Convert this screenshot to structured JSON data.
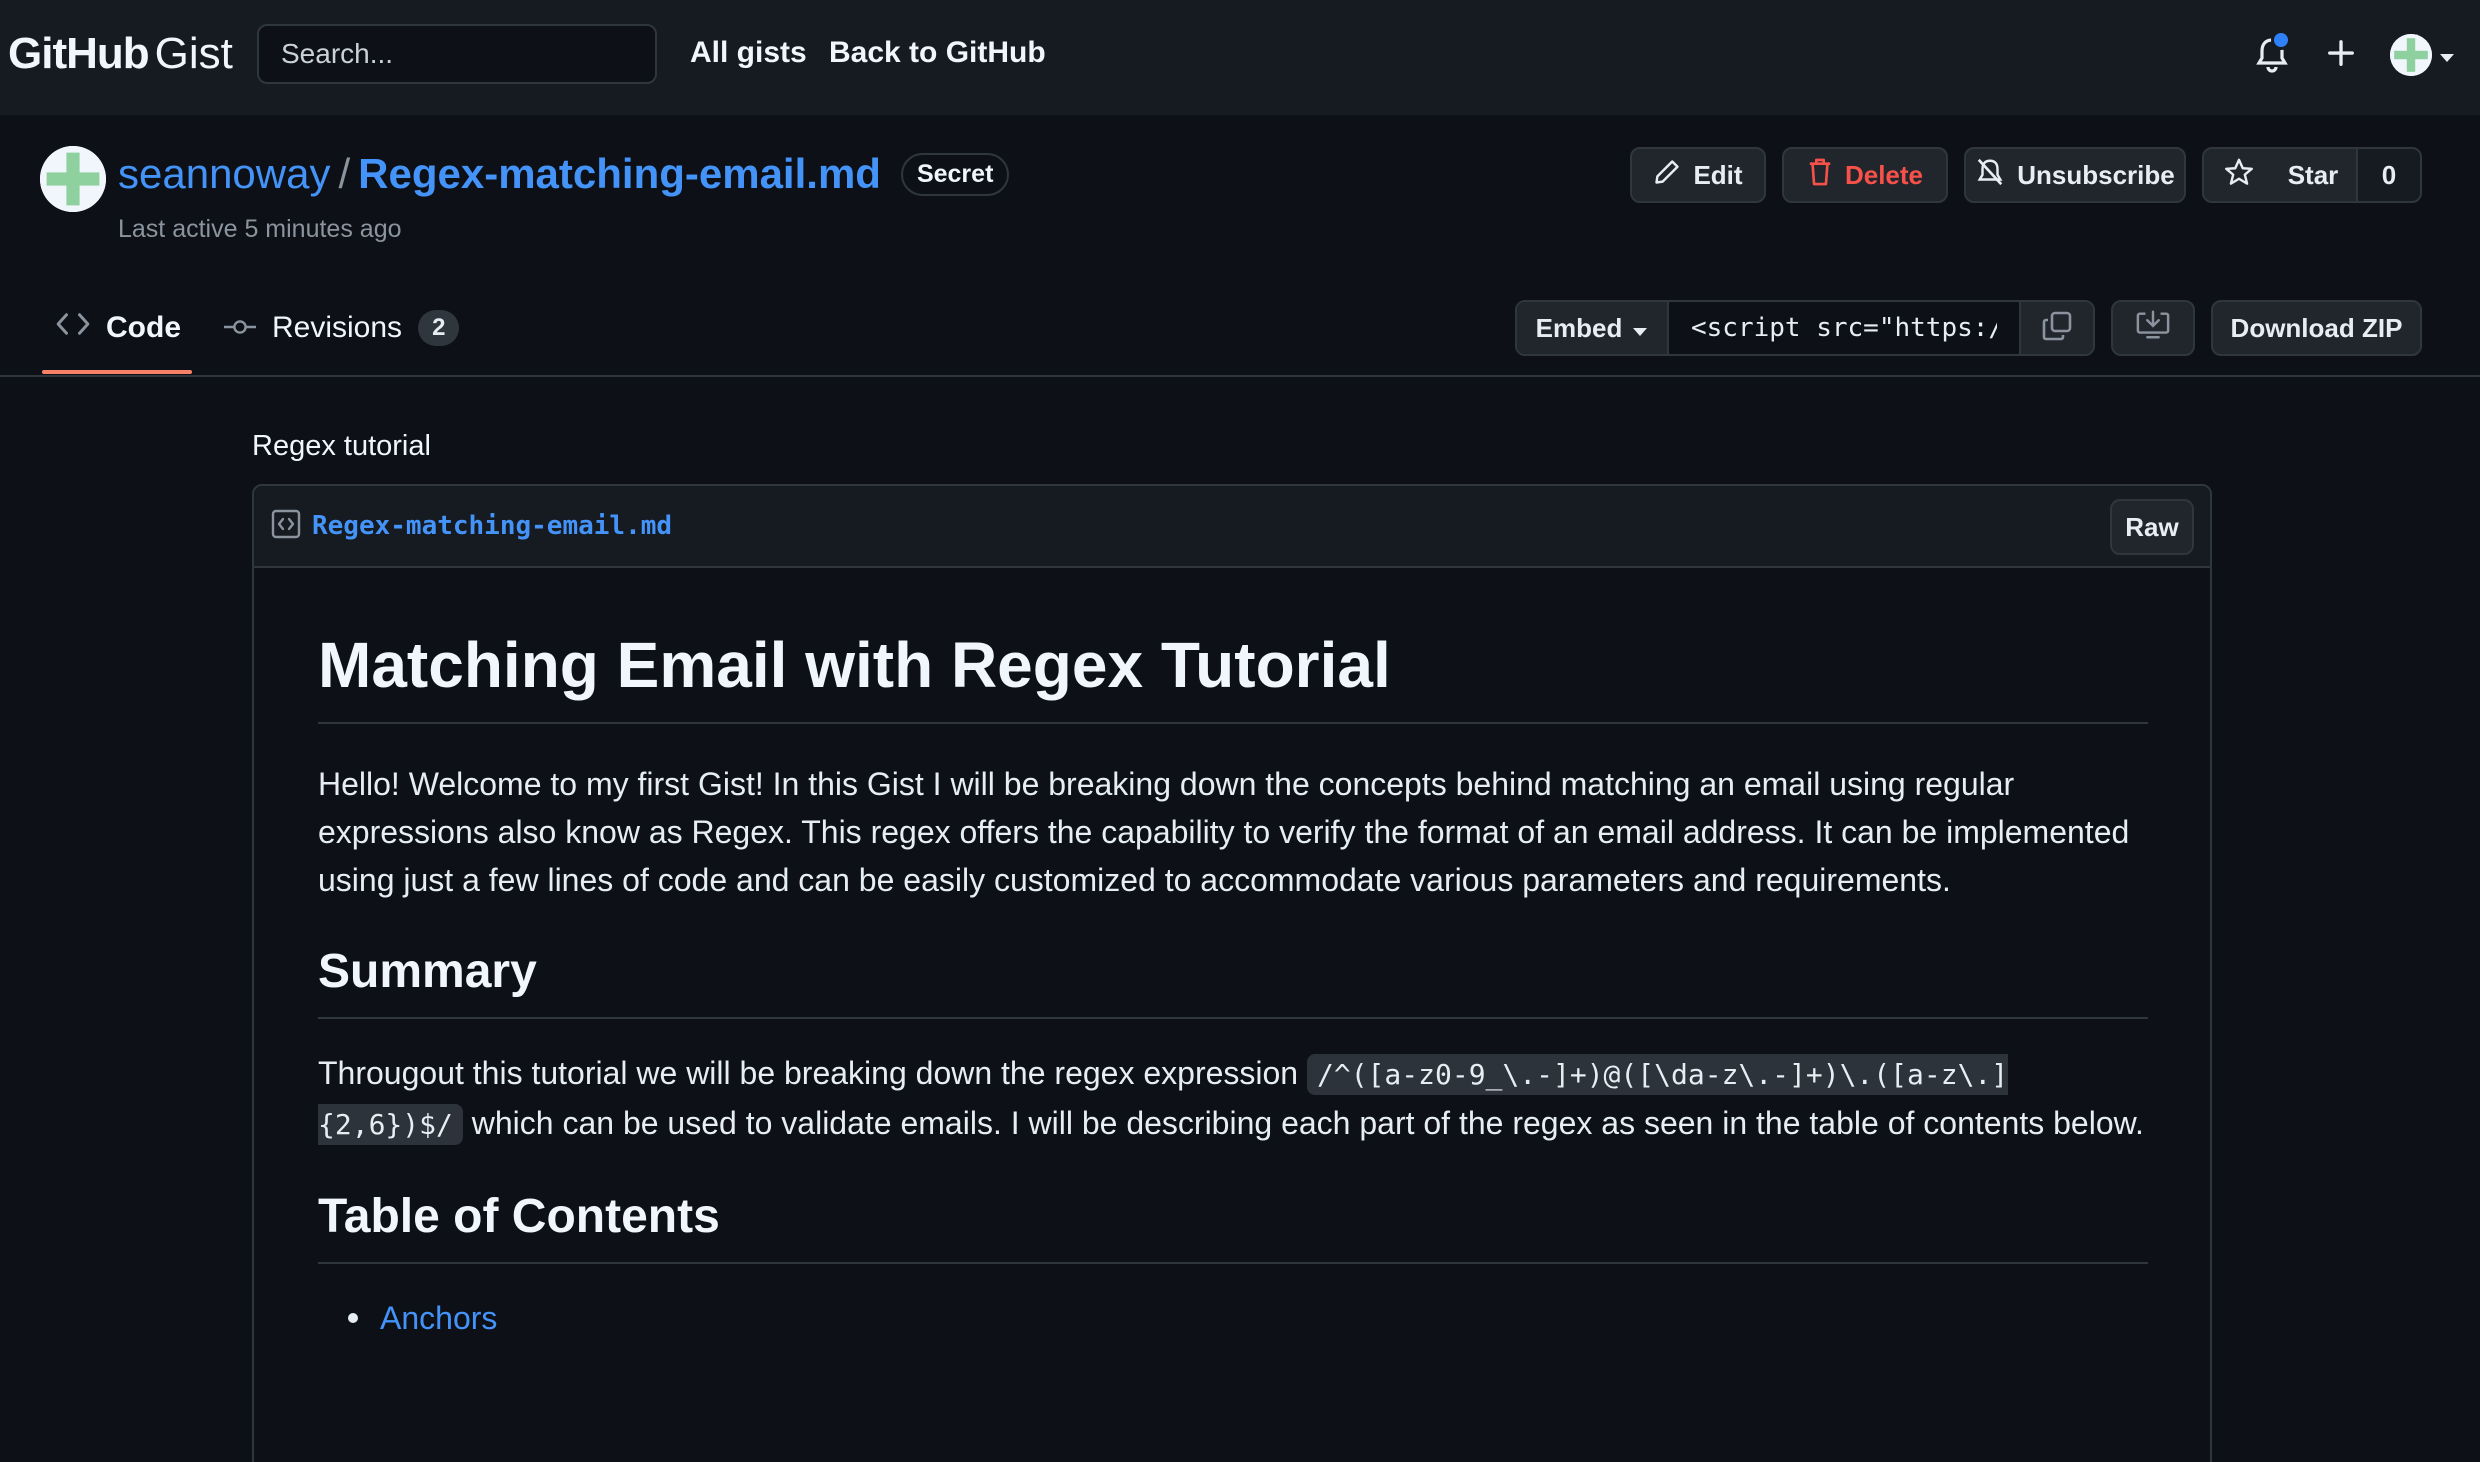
{
  "header": {
    "logo_primary": "GitHub",
    "logo_secondary": "Gist",
    "search_placeholder": "Search...",
    "links": [
      "All gists",
      "Back to GitHub"
    ],
    "icons": [
      "bell-icon",
      "plus-icon",
      "avatar"
    ]
  },
  "gist": {
    "owner": "seannoway",
    "separator": "/",
    "filename": "Regex-matching-email.md",
    "visibility": "Secret",
    "last_active": "Last active 5 minutes ago",
    "actions": {
      "edit": "Edit",
      "delete": "Delete",
      "unsubscribe": "Unsubscribe",
      "star": "Star",
      "star_count": "0"
    }
  },
  "tabs": {
    "code": "Code",
    "revisions": "Revisions",
    "revisions_count": "2"
  },
  "embed": {
    "label": "Embed",
    "value": "<script src=\"https://",
    "download_zip": "Download ZIP"
  },
  "content": {
    "description": "Regex tutorial",
    "file_name": "Regex-matching-email.md",
    "raw_label": "Raw",
    "h1": "Matching Email with Regex Tutorial",
    "intro": "Hello! Welcome to my first Gist! In this Gist I will be breaking down the concepts behind matching an email using regular expressions also know as Regex. This regex offers the capability to verify the format of an email address. It can be implemented using just a few lines of code and can be easily customized to accommodate various parameters and requirements.",
    "summary_heading": "Summary",
    "summary_before": "Througout this tutorial we will be breaking down the regex expression ",
    "summary_code": "/^([a-z0-9_\\.-]+)@([\\da-z\\.-]+)\\.([a-z\\.]{2,6})$/",
    "summary_after": " which can be used to validate emails. I will be describing each part of the regex as seen in the table of contents below.",
    "toc_heading": "Table of Contents",
    "toc_items": [
      "Anchors"
    ]
  },
  "colors": {
    "background": "#0d1117",
    "header": "#161b22",
    "link": "#4493f8",
    "danger": "#f85149",
    "tab_underline": "#f78166",
    "notification_dot": "#2f81f7"
  }
}
